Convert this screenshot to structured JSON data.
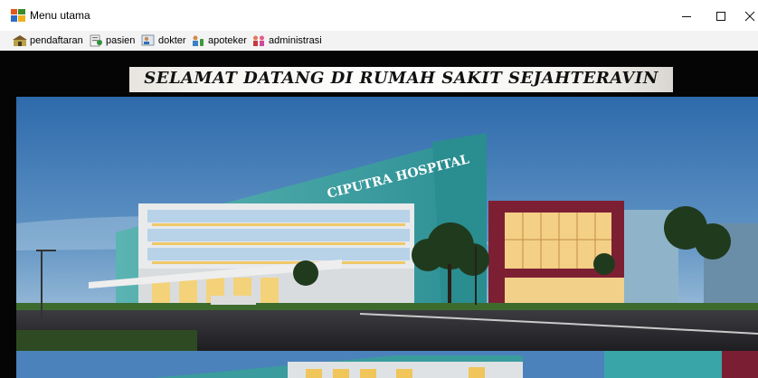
{
  "window": {
    "title": "Menu utama",
    "controls": {
      "minimize": "minimize-icon",
      "maximize": "maximize-icon",
      "close": "close-icon"
    }
  },
  "menu": {
    "items": [
      {
        "label": "pendaftaran",
        "icon": "registration-icon"
      },
      {
        "label": "pasien",
        "icon": "patient-icon"
      },
      {
        "label": "dokter",
        "icon": "doctor-icon"
      },
      {
        "label": "apoteker",
        "icon": "pharmacist-icon"
      },
      {
        "label": "administrasi",
        "icon": "administration-icon"
      }
    ]
  },
  "main": {
    "welcome": "SELAMAT DATANG DI RUMAH SAKIT SEJAHTERAVIN",
    "photo_sign": "CIPUTRA HOSPITAL"
  },
  "colors": {
    "sky_top": "#2f6fb0",
    "sky_bottom": "#a9c8de",
    "facade_teal": "#3fa3a3",
    "accent_red": "#8f2236"
  }
}
